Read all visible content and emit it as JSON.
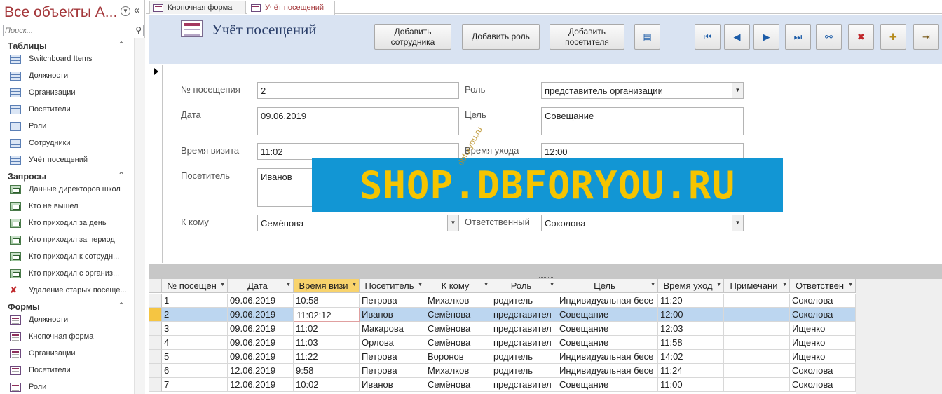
{
  "nav": {
    "title": "Все объекты А...",
    "search_placeholder": "Поиск...",
    "groups": [
      {
        "label": "Таблицы",
        "items": [
          "Switchboard Items",
          "Должности",
          "Организации",
          "Посетители",
          "Роли",
          "Сотрудники",
          "Учёт посещений"
        ]
      },
      {
        "label": "Запросы",
        "items": [
          "Данные директоров школ",
          "Кто не вышел",
          "Кто приходил за день",
          "Кто приходил за период",
          "Кто приходил к сотрудн...",
          "Кто приходил с организ...",
          "Удаление старых посеще..."
        ]
      },
      {
        "label": "Формы",
        "items": [
          "Должности",
          "Кнопочная форма",
          "Организации",
          "Посетители",
          "Роли"
        ]
      }
    ]
  },
  "tabs": [
    {
      "label": "Кнопочная форма"
    },
    {
      "label": "Учёт посещений"
    }
  ],
  "header": {
    "title": "Учёт посещений",
    "btn_add_employee": "Добавить сотрудника",
    "btn_add_role": "Добавить роль",
    "btn_add_visitor": "Добавить посетителя"
  },
  "form": {
    "visit_no_label": "№ посещения",
    "visit_no": "2",
    "date_label": "Дата",
    "date": "09.06.2019",
    "time_in_label": "Время визита",
    "time_in": "11:02",
    "visitor_label": "Посетитель",
    "visitor": "Иванов",
    "to_whom_label": "К кому",
    "to_whom": "Семёнова",
    "role_label": "Роль",
    "role": "представитель организации",
    "purpose_label": "Цель",
    "purpose": "Совещание",
    "time_out_label": "Время ухода",
    "time_out": "12:00",
    "responsible_label": "Ответственный",
    "responsible": "Соколова"
  },
  "watermark": {
    "text": "SHOP.DBFORYOU.RU",
    "small": "dbforyou.ru"
  },
  "datasheet": {
    "columns": [
      "№ посещен",
      "Дата",
      "Время визи",
      "Посетитель",
      "К кому",
      "Роль",
      "Цель",
      "Время уход",
      "Примечани",
      "Ответствен"
    ],
    "rows": [
      [
        "1",
        "09.06.2019",
        "10:58",
        "Петрова",
        "Михалков",
        "родитель",
        "Индивидуальная бесе",
        "11:20",
        "",
        "Соколова"
      ],
      [
        "2",
        "09.06.2019",
        "11:02:12",
        "Иванов",
        "Семёнова",
        "представител",
        "Совещание",
        "12:00",
        "",
        "Соколова"
      ],
      [
        "3",
        "09.06.2019",
        "11:02",
        "Макарова",
        "Семёнова",
        "представител",
        "Совещание",
        "12:03",
        "",
        "Ищенко"
      ],
      [
        "4",
        "09.06.2019",
        "11:03",
        "Орлова",
        "Семёнова",
        "представител",
        "Совещание",
        "11:58",
        "",
        "Ищенко"
      ],
      [
        "5",
        "09.06.2019",
        "11:22",
        "Петрова",
        "Воронов",
        "родитель",
        "Индивидуальная бесе",
        "14:02",
        "",
        "Ищенко"
      ],
      [
        "6",
        "12.06.2019",
        "9:58",
        "Петрова",
        "Михалков",
        "родитель",
        "Индивидуальная бесе",
        "11:24",
        "",
        "Соколова"
      ],
      [
        "7",
        "12.06.2019",
        "10:02",
        "Иванов",
        "Семёнова",
        "представител",
        "Совещание",
        "11:00",
        "",
        "Соколова"
      ]
    ]
  },
  "colors": {
    "accent": "#a4373a",
    "header_bg": "#d9e3f2",
    "row_selected": "#bcd6f0",
    "watermark_bg": "#1296d4",
    "watermark_fg": "#f5c400"
  }
}
